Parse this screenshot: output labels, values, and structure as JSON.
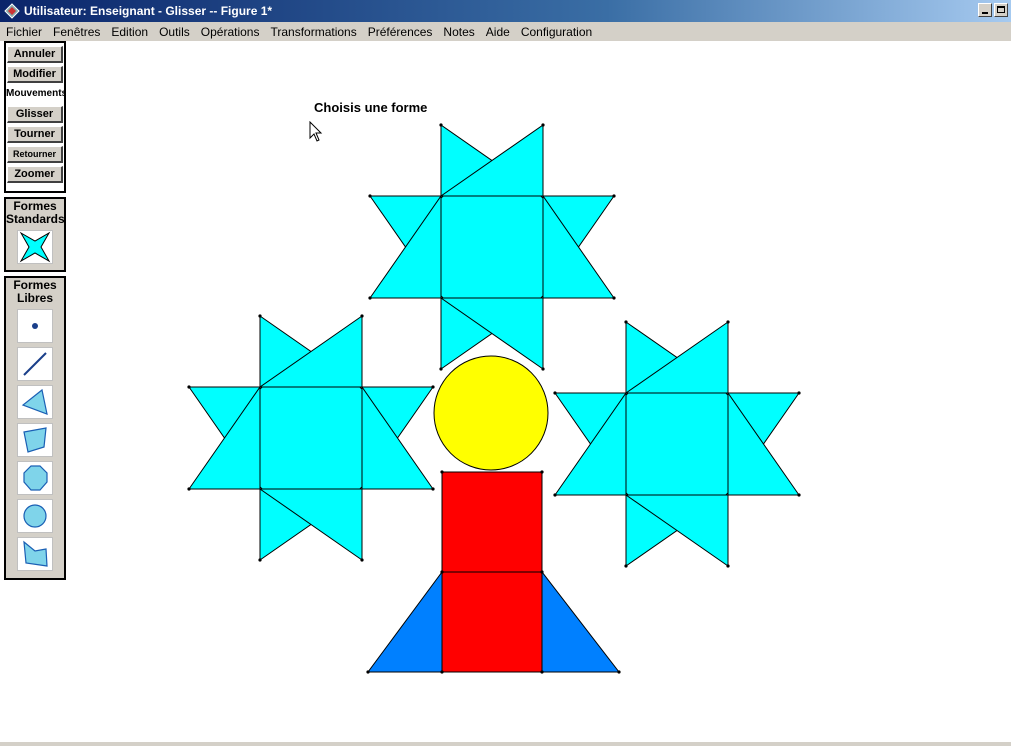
{
  "window": {
    "title": "Utilisateur: Enseignant - Glisser -- Figure 1*",
    "icon": "geometry-app-icon"
  },
  "menubar": {
    "items": [
      "Fichier",
      "Fenêtres",
      "Edition",
      "Outils",
      "Opérations",
      "Transformations",
      "Préférences",
      "Notes",
      "Aide",
      "Configuration"
    ]
  },
  "toolbar": {
    "undo": "Annuler",
    "modify": "Modifier",
    "movements": "Mouvements",
    "slide": "Glisser",
    "turn": "Tourner",
    "flip": "Retourner",
    "zoom": "Zoomer"
  },
  "standard_shapes": {
    "title_line1": "Formes",
    "title_line2": "Standards",
    "items": [
      "four-point-star-icon"
    ]
  },
  "free_shapes": {
    "title_line1": "Formes",
    "title_line2": "Libres",
    "items": [
      "point-icon",
      "segment-icon",
      "triangle-icon",
      "quadrilateral-icon",
      "polygon-icon",
      "circle-icon",
      "free-polygon-icon"
    ]
  },
  "canvas": {
    "prompt": "Choisis une forme"
  },
  "colors": {
    "star": "#00ffff",
    "circle": "#ffff00",
    "rectangle": "#ff0000",
    "triangle": "#0080ff",
    "icon_fill": "#7fd4ea",
    "icon_stroke": "#1a5fb4"
  }
}
